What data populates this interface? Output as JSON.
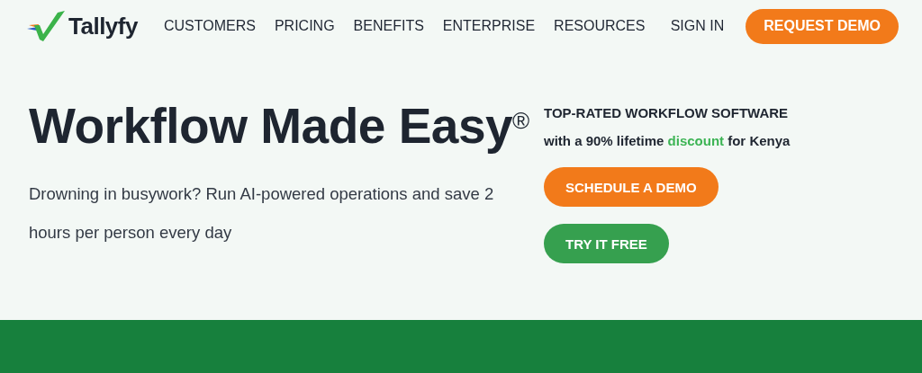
{
  "header": {
    "logo": "Tallyfy",
    "nav": [
      "CUSTOMERS",
      "PRICING",
      "BENEFITS",
      "ENTERPRISE",
      "RESOURCES"
    ],
    "sign_in": "SIGN IN",
    "cta": "REQUEST DEMO"
  },
  "hero": {
    "title": "Workflow Made Easy$^{®}$",
    "lead": "Drowning in busywork? Run AI-powered operations and save 2 hours per person every day",
    "badge": "TOP-RATED WORKFLOW SOFTWARE",
    "offer": {
      "before": "with a 90% lifetime ",
      "highlight": "discount",
      "after": " for Kenya"
    },
    "buttons": [
      {
        "label": "SCHEDULE A DEMO",
        "kind": "primary"
      },
      {
        "label": "TRY IT FREE",
        "kind": "secondary"
      }
    ]
  }
}
